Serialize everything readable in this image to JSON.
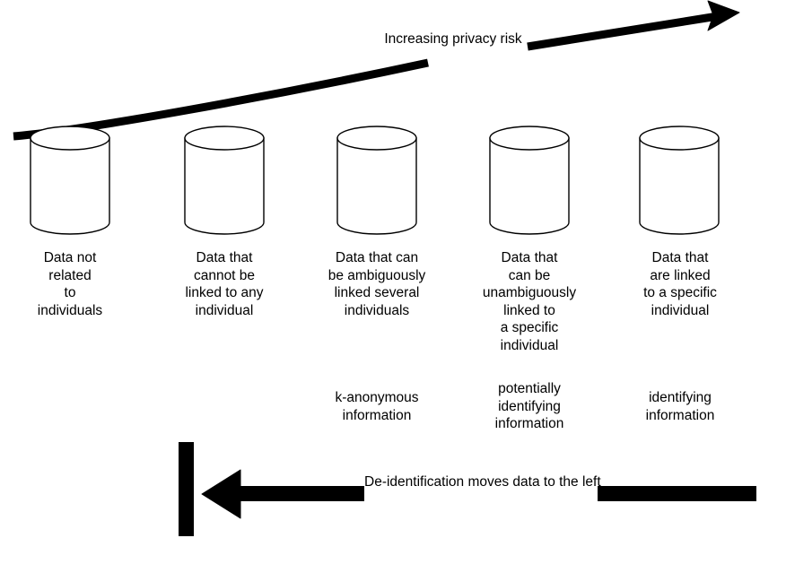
{
  "diagram": {
    "title": "Privacy risk / de-identification spectrum",
    "colors": {
      "stroke": "#000000",
      "fill": "#ffffff",
      "background": "#ffffff"
    },
    "top_arrow": {
      "caption_line1": "Increasing",
      "caption_line2": "privacy risk",
      "direction": "right-up"
    },
    "bottom_arrow": {
      "caption_line1": "De-identification moves data",
      "caption_line2": "to the left",
      "direction": "left"
    },
    "stages": [
      {
        "id": "stage-1",
        "lines": [
          "Data not",
          "related",
          "to",
          "individuals"
        ],
        "classification": []
      },
      {
        "id": "stage-2",
        "lines": [
          "Data that",
          "cannot be",
          "linked to any",
          "individual"
        ],
        "classification": []
      },
      {
        "id": "stage-3",
        "lines": [
          "Data that can",
          "be ambiguously",
          "linked several",
          "individuals"
        ],
        "classification": [
          "k-anonymous",
          "information"
        ]
      },
      {
        "id": "stage-4",
        "lines": [
          "Data that",
          "can be",
          "unambiguously",
          "linked to",
          "a specific",
          "individual"
        ],
        "classification": [
          "potentially",
          "identifying",
          "information"
        ]
      },
      {
        "id": "stage-5",
        "lines": [
          "Data that",
          "are linked",
          "to a specific",
          "individual"
        ],
        "classification": [
          "identifying",
          "information"
        ]
      }
    ]
  }
}
